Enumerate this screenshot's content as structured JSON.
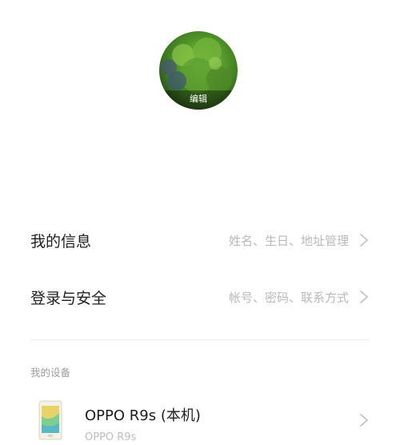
{
  "avatar": {
    "edit_label": "编辑"
  },
  "settings": {
    "items": [
      {
        "title": "我的信息",
        "detail": "姓名、生日、地址管理"
      },
      {
        "title": "登录与安全",
        "detail": "帐号、密码、联系方式"
      }
    ]
  },
  "devices": {
    "section_label": "我的设备",
    "items": [
      {
        "name": "OPPO R9s (本机)",
        "model": "OPPO R9s"
      }
    ]
  },
  "colors": {
    "primary_text": "#1e1e1e",
    "secondary_text": "#b9b9b9",
    "section_text": "#9d9d9d",
    "divider": "#ececec"
  },
  "icons": {
    "row_arrow": "chevron-right-icon",
    "device": "phone-icon"
  }
}
